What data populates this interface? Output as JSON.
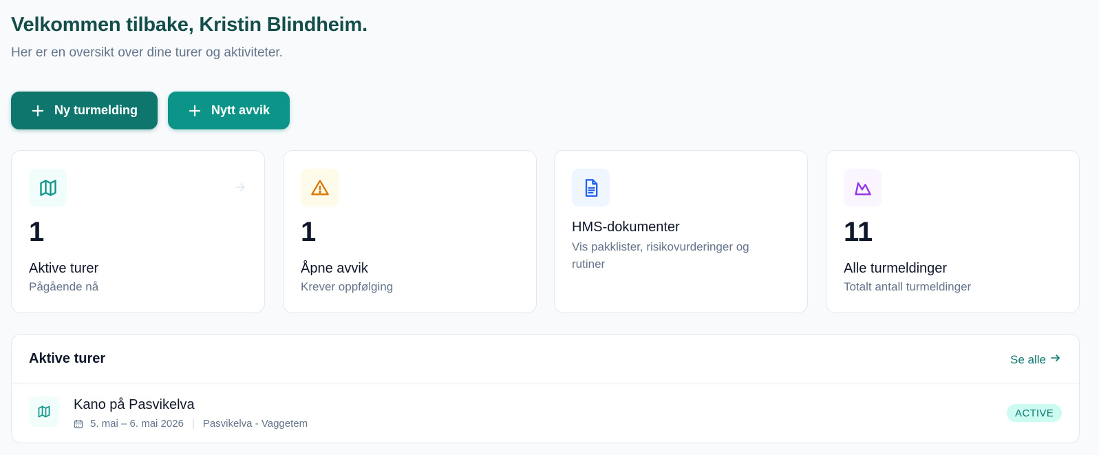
{
  "header": {
    "title": "Velkommen tilbake, Kristin Blindheim.",
    "subtitle": "Her er en oversikt over dine turer og aktiviteter."
  },
  "actions": {
    "new_trip_label": "Ny turmelding",
    "new_deviation_label": "Nytt avvik"
  },
  "stats": {
    "active_trips": {
      "value": "1",
      "label": "Aktive turer",
      "sub": "Pågående nå",
      "icon": "map-icon"
    },
    "open_deviations": {
      "value": "1",
      "label": "Åpne avvik",
      "sub": "Krever oppfølging",
      "icon": "warning-icon"
    },
    "hms_documents": {
      "label": "HMS-dokumenter",
      "sub": "Vis pakklister, risikovurderinger og rutiner",
      "icon": "document-icon"
    },
    "all_trips": {
      "value": "11",
      "label": "Alle turmeldinger",
      "sub": "Totalt antall turmeldinger",
      "icon": "mountain-icon"
    }
  },
  "active_trips_panel": {
    "title": "Aktive turer",
    "see_all": "Se alle",
    "trips": [
      {
        "name": "Kano på Pasvikelva",
        "dates": "5. mai – 6. mai 2026",
        "location": "Pasvikelva - Vaggetem",
        "status": "ACTIVE"
      }
    ]
  },
  "colors": {
    "brand_dark": "#0f766e",
    "brand": "#0d9488",
    "title": "#134e4a",
    "warning": "#d97706",
    "document": "#2563eb",
    "mountain": "#9333ea"
  }
}
